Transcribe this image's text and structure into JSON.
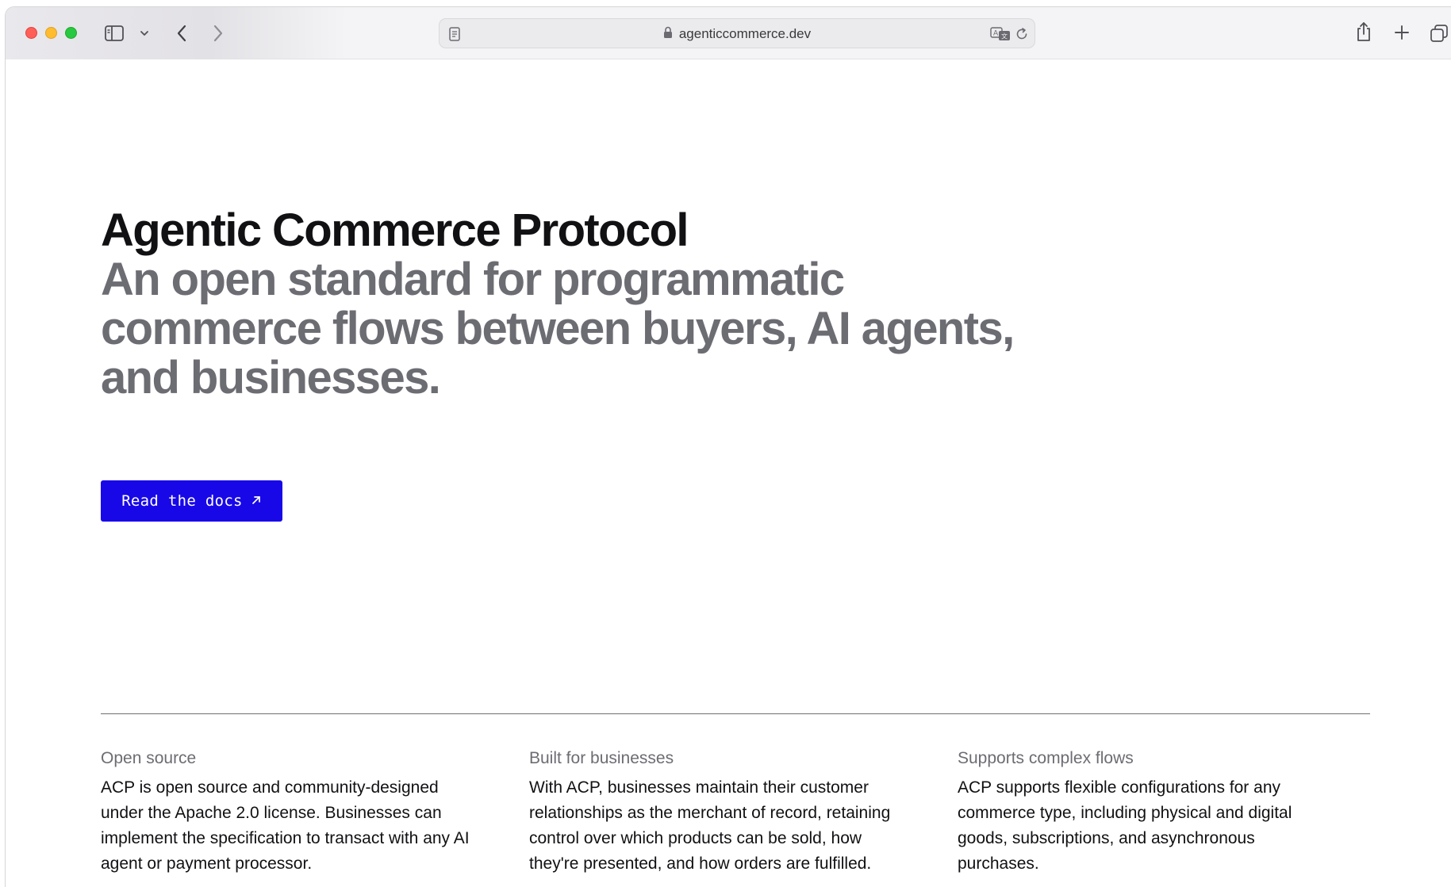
{
  "browser": {
    "url": "agenticcommerce.dev",
    "icons": {
      "sidebar": "sidebar-icon",
      "sidebar_menu": "chevron-down-icon",
      "back": "chevron-left-icon",
      "forward": "chevron-right-icon",
      "reader": "reader-icon",
      "lock": "lock-icon",
      "translate": "translate-icon",
      "reload": "reload-icon",
      "share": "share-icon",
      "new_tab": "plus-icon",
      "tab_overview": "tab-overview-icon"
    }
  },
  "hero": {
    "title": "Agentic Commerce Protocol",
    "subtitle": "An open standard for programmatic commerce flows between buyers, AI agents, and businesses.",
    "cta_label": "Read the docs",
    "cta_icon": "arrow-up-right-icon"
  },
  "features": [
    {
      "title": "Open source",
      "body": "ACP is open source and community-designed under the Apache 2.0 license. Businesses can implement the specification to transact with any AI agent or payment processor."
    },
    {
      "title": "Built for businesses",
      "body": "With ACP, businesses maintain their customer relationships as the merchant of record, retaining control over which products can be sold, how they're presented, and how orders are fulfilled."
    },
    {
      "title": "Supports complex flows",
      "body": "ACP supports flexible configurations for any commerce type, including physical and digital goods, subscriptions, and asynchronous purchases."
    }
  ],
  "colors": {
    "cta_background": "#1808e8",
    "title": "#111114",
    "subtitle": "#6c6c73"
  }
}
